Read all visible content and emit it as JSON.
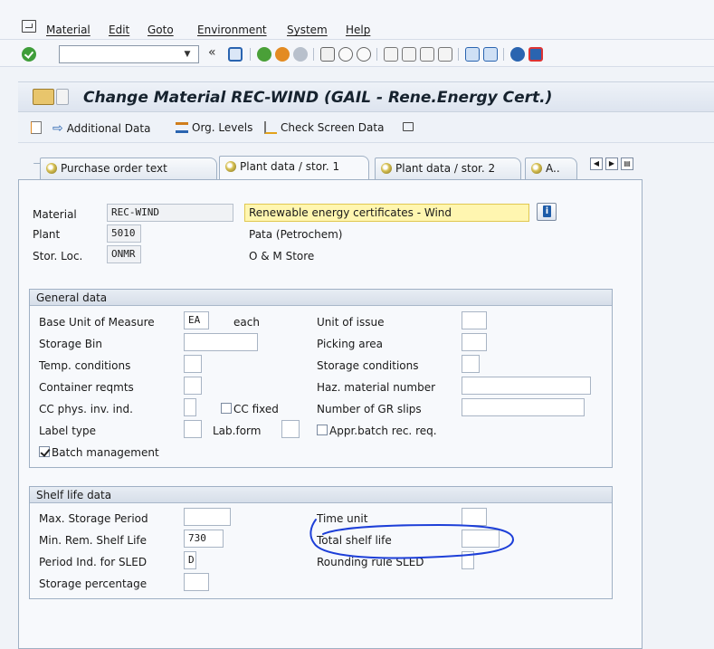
{
  "menu": [
    "Material",
    "Edit",
    "Goto",
    "Environment",
    "System",
    "Help"
  ],
  "toolbar": {
    "command_value": "",
    "back_symbol": "«"
  },
  "title": "Change Material REC-WIND (GAIL - Rene.Energy Cert.)",
  "app_toolbar": {
    "additional_data": "Additional Data",
    "org_levels": "Org. Levels",
    "check_screen_data": "Check Screen Data"
  },
  "tabs": [
    "Purchase order text",
    "Plant data / stor. 1",
    "Plant data / stor. 2",
    "A.."
  ],
  "header": {
    "material_label": "Material",
    "material_value": "REC-WIND",
    "material_desc": "Renewable energy certificates - Wind",
    "plant_label": "Plant",
    "plant_value": "5010",
    "plant_desc": "Pata (Petrochem)",
    "storloc_label": "Stor. Loc.",
    "storloc_value": "ONMR",
    "storloc_desc": "O & M Store"
  },
  "general": {
    "title": "General data",
    "base_uom_label": "Base Unit of Measure",
    "base_uom_value": "EA",
    "base_uom_text": "each",
    "unit_issue_label": "Unit of issue",
    "storage_bin_label": "Storage Bin",
    "picking_area_label": "Picking area",
    "temp_cond_label": "Temp. conditions",
    "storage_cond_label": "Storage conditions",
    "container_label": "Container reqmts",
    "haz_label": "Haz. material number",
    "cc_phys_label": "CC phys. inv. ind.",
    "cc_fixed_label": "CC fixed",
    "gr_slips_label": "Number of GR slips",
    "label_type_label": "Label type",
    "lab_form_label": "Lab.form",
    "appr_batch_label": "Appr.batch rec. req.",
    "batch_mgmt_label": "Batch management"
  },
  "shelf": {
    "title": "Shelf life data",
    "max_storage_label": "Max. Storage Period",
    "time_unit_label": "Time unit",
    "min_rem_label": "Min. Rem. Shelf Life",
    "min_rem_value": "730",
    "total_shelf_label": "Total shelf life",
    "period_ind_label": "Period Ind. for SLED",
    "period_ind_value": "D",
    "rounding_label": "Rounding rule SLED",
    "storage_pct_label": "Storage percentage"
  },
  "colors": {
    "annotation": "#1d3fd8",
    "title_bg": "#dde4ef",
    "highlight": "#fff6b0"
  }
}
